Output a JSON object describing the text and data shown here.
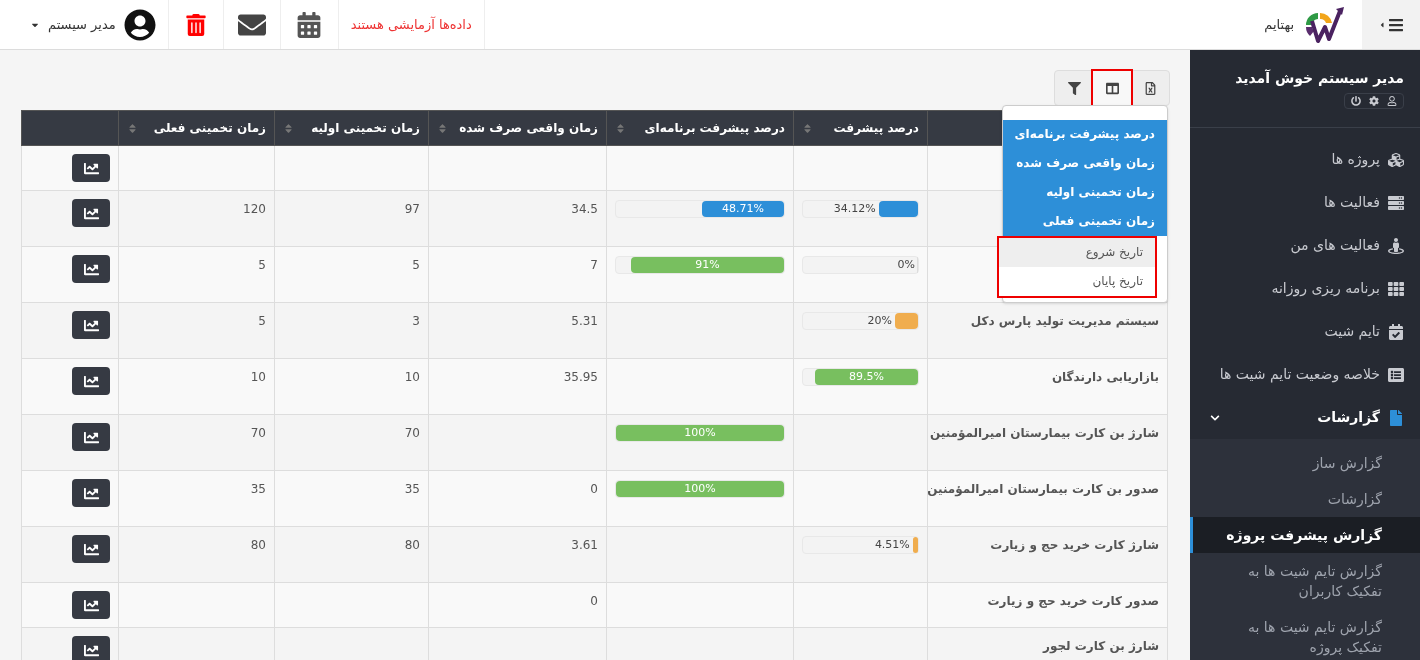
{
  "header": {
    "brand": "بهتایم",
    "notice": "داده‌ها آزمایشی هستند",
    "user": "مدیر سیستم"
  },
  "sidebar": {
    "welcome": "مدیر سیستم خوش آمدید",
    "items": [
      {
        "label": "پروژه ها",
        "selected": false
      },
      {
        "label": "فعالیت ها",
        "selected": false
      },
      {
        "label": "فعالیت های من",
        "selected": false
      },
      {
        "label": "برنامه ریزی روزانه",
        "selected": false
      },
      {
        "label": "تایم شیت",
        "selected": false
      },
      {
        "label": "خلاصه وضعیت تایم شیت ها",
        "selected": false
      },
      {
        "label": "گزارشات",
        "selected": false,
        "expanded": true,
        "children": [
          {
            "label": "گزارش ساز",
            "selected": false
          },
          {
            "label": "گزارشات",
            "selected": false
          },
          {
            "label": "گزارش پیشرفت پروژه",
            "selected": true
          },
          {
            "label": "گزارش تایم شیت ها به تفکیک کاربران",
            "selected": false
          },
          {
            "label": "گزارش تایم شیت ها به تفکیک پروژه",
            "selected": false
          }
        ]
      }
    ]
  },
  "toolbar": [
    {
      "kind": "excel",
      "highlighted": false
    },
    {
      "kind": "columns",
      "highlighted": true
    },
    {
      "kind": "filter",
      "highlighted": false
    }
  ],
  "column_menu": {
    "items": [
      {
        "label": "درصد پیشرفت برنامه‌ای",
        "selected": true
      },
      {
        "label": "زمان واقعی صرف شده",
        "selected": true
      },
      {
        "label": "زمان تخمینی اولیه",
        "selected": true
      },
      {
        "label": "زمان تخمینی فعلی",
        "selected": true
      },
      {
        "label": "تاریخ شروع",
        "selected": false,
        "hovered": true,
        "highlighted": true
      },
      {
        "label": "تاریخ پایان",
        "selected": false,
        "hovered": false,
        "highlighted": true
      }
    ]
  },
  "table": {
    "columns": [
      "درصد پیشرفت",
      "درصد پیشرفت برنامه‌ای",
      "زمان واقعی صرف شده",
      "زمان تخمینی اولیه",
      "زمان تخمینی فعلی"
    ],
    "rows": [
      {},
      {
        "progress": {
          "label": "34.12%",
          "level": 0.3412,
          "color": "#2d8fd8"
        },
        "planned": {
          "label": "48.71%",
          "level": 0.4871,
          "color": "#2d8fd8"
        },
        "actual": "34.5",
        "initial": "97",
        "current": "120"
      },
      {
        "progress": {
          "label": "0%",
          "level": 0
        },
        "planned": {
          "label": "91%",
          "level": 0.91,
          "color": "#78bf5f"
        },
        "actual": "7",
        "initial": "5",
        "current": "5"
      },
      {
        "name": "سیستم مدیریت تولید پارس دکل",
        "progress": {
          "label": "20%",
          "level": 0.2,
          "color": "#f0ad4e"
        },
        "actual": "5.31",
        "initial": "3",
        "current": "5"
      },
      {
        "name": "بازاریابی دارندگان",
        "progress": {
          "label": "89.5%",
          "level": 0.895,
          "color": "#78bf5f"
        },
        "actual": "35.95",
        "initial": "10",
        "current": "10"
      },
      {
        "name": "شارژ بن کارت بیمارستان امیرالمؤمنین",
        "planned": {
          "label": "100%",
          "level": 1,
          "color": "#78bf5f"
        },
        "initial": "70",
        "current": "70"
      },
      {
        "name": "صدور بن کارت بیمارستان امیرالمؤمنین",
        "planned": {
          "label": "100%",
          "level": 1,
          "color": "#78bf5f"
        },
        "actual": "0",
        "initial": "35",
        "current": "35"
      },
      {
        "name": "شارژ کارت خرید حج و زیارت",
        "progress": {
          "label": "4.51%",
          "level": 0.0451,
          "color": "#f0ad4e"
        },
        "actual": "3.61",
        "initial": "80",
        "current": "80"
      },
      {
        "name": "صدور کارت خرید حج و زیارت",
        "actual": "0"
      },
      {
        "name": "شارژ بن کارت لجور"
      }
    ]
  }
}
